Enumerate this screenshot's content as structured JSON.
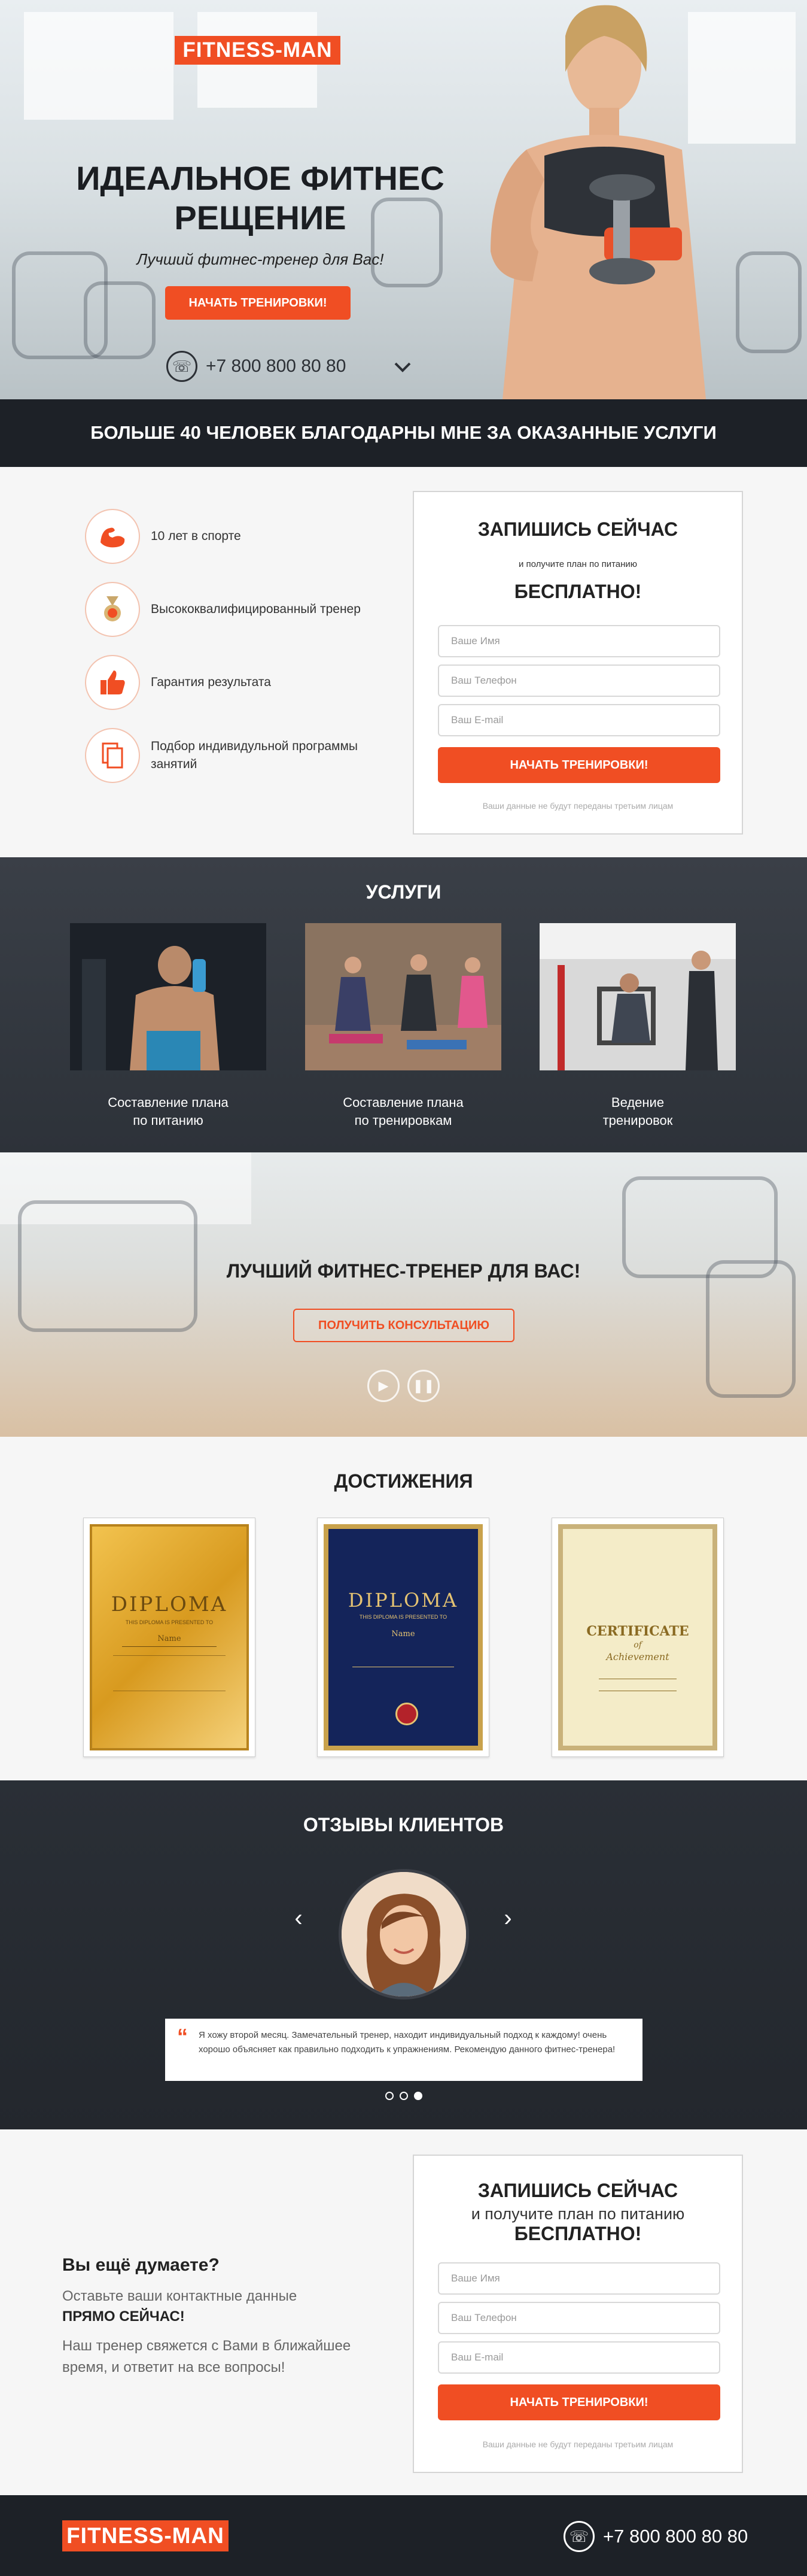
{
  "hero": {
    "logo": "FITNESS-MAN",
    "title": "ИДЕАЛЬНОЕ ФИТНЕС РЕЩЕНИЕ",
    "subtitle": "Лучший фитнес-тренер для Вас!",
    "cta": "НАЧАТЬ ТРЕНИРОВКИ!",
    "phone": "+7 800 800 80 80"
  },
  "banner": {
    "text": "БОЛЬШЕ 40 ЧЕЛОВЕК БЛАГОДАРНЫ МНЕ ЗА ОКАЗАННЫЕ УСЛУГИ"
  },
  "features": {
    "items": [
      {
        "label": "10 лет в спорте",
        "icon": "biceps-icon"
      },
      {
        "label": "Высококвалифицированный тренер",
        "icon": "medal-icon"
      },
      {
        "label": "Гарантия результата",
        "icon": "thumbs-up-icon"
      },
      {
        "label": "Подбор индивидульной программы занятий",
        "icon": "documents-icon"
      }
    ]
  },
  "form1": {
    "title": "ЗАПИШИСЬ СЕЙЧАС",
    "subtitle": "и получите план по питанию",
    "free": "БЕСПЛАТНО!",
    "name_placeholder": "Ваше Имя",
    "phone_placeholder": "Ваш Телефон",
    "email_placeholder": "Ваш E-mail",
    "submit": "НАЧАТЬ ТРЕНИРОВКИ!",
    "note": "Ваши данные не будут переданы третьим лицам"
  },
  "services": {
    "title": "УСЛУГИ",
    "items": [
      {
        "line1": "Составление плана",
        "line2": "по питанию"
      },
      {
        "line1": "Составление плана",
        "line2": "по тренировкам"
      },
      {
        "line1": "Ведение",
        "line2": "тренировок"
      }
    ]
  },
  "cta": {
    "title": "ЛУЧШИЙ ФИТНЕС-ТРЕНЕР ДЛЯ ВАС!",
    "button": "ПОЛУЧИТЬ КОНСУЛЬТАЦИЮ"
  },
  "achievements": {
    "title": "ДОСТИЖЕНИЯ",
    "certs": [
      {
        "heading": "DIPLOMA",
        "line": "THIS DIPLOMA IS PRESENTED TO",
        "name": "Name"
      },
      {
        "heading": "DIPLOMA",
        "line": "THIS DIPLOMA IS PRESENTED TO",
        "name": "Name"
      },
      {
        "heading": "CERTIFICATE",
        "line": "of",
        "name": "Achievement"
      }
    ]
  },
  "reviews": {
    "title": "ОТЗЫВЫ КЛИЕНТОВ",
    "quote": "Я хожу второй месяц. Замечательный тренер, находит индивидуальный подход к каждому! очень хорошо объясняет как правильно подходить к упражнениям. Рекомендую данного фитнес-тренера!",
    "active_slide": 3
  },
  "bottom": {
    "question": "Вы ещё думаете?",
    "line1": "Оставьте ваши контактные данные",
    "line2": "ПРЯМО СЕЙЧАС!",
    "line3": "Наш тренер свяжется с Вами в ближайшее время, и ответит на все вопросы!"
  },
  "form2": {
    "title": "ЗАПИШИСЬ СЕЙЧАС",
    "subtitle": "и получите план по питанию",
    "free": "БЕСПЛАТНО!",
    "name_placeholder": "Ваше Имя",
    "phone_placeholder": "Ваш Телефон",
    "email_placeholder": "Ваш E-mail",
    "submit": "НАЧАТЬ ТРЕНИРОВКИ!",
    "note": "Ваши данные не будут переданы третьим лицам"
  },
  "footer": {
    "logo": "FITNESS-MAN",
    "phone": "+7 800 800 80 80"
  },
  "colors": {
    "accent": "#f04e23",
    "dark": "#1d2127"
  }
}
